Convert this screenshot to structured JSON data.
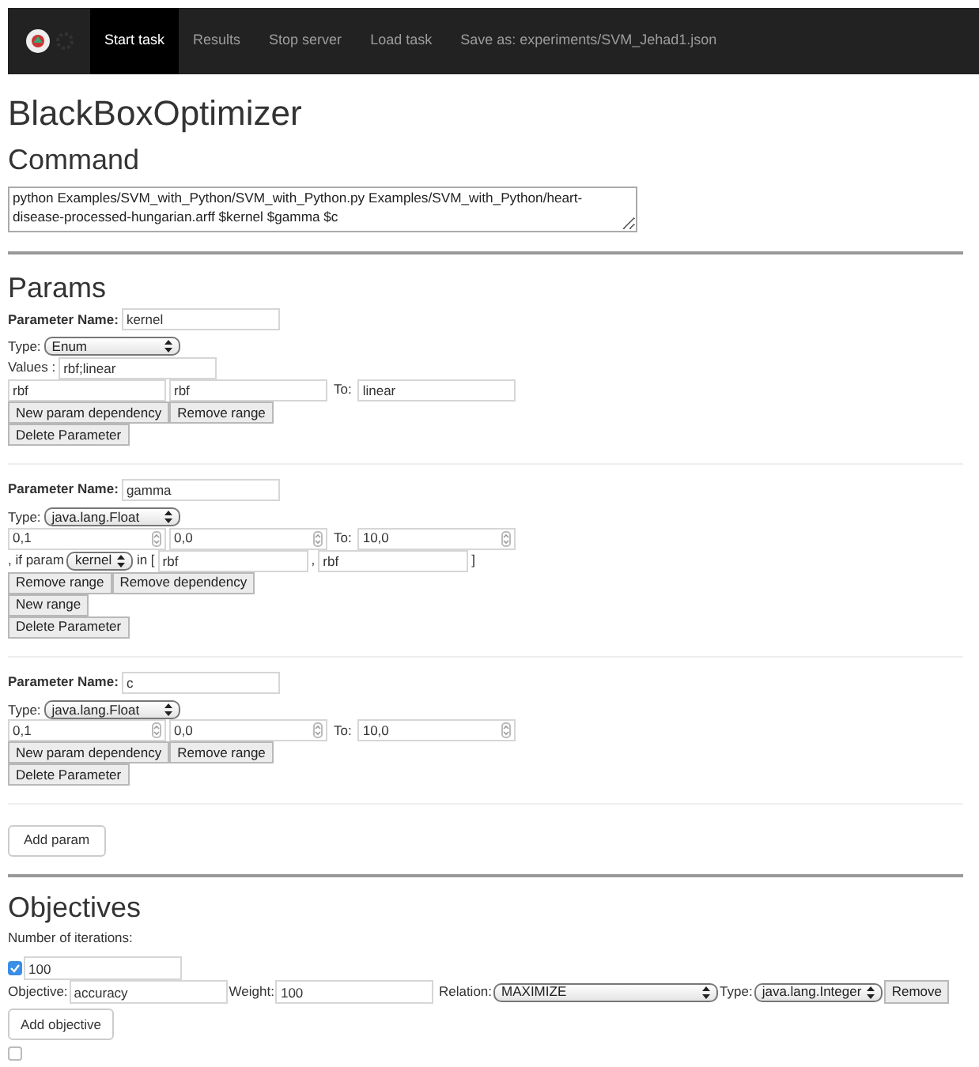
{
  "navbar": {
    "items": [
      {
        "label": "Start task",
        "selected": true
      },
      {
        "label": "Results",
        "selected": false
      },
      {
        "label": "Stop server",
        "selected": false
      },
      {
        "label": "Load task",
        "selected": false
      },
      {
        "label": "Save as: experiments/SVM_Jehad1.json",
        "selected": false
      }
    ]
  },
  "title": "BlackBoxOptimizer",
  "command": {
    "heading": "Command",
    "value": "python Examples/SVM_with_Python/SVM_with_Python.py Examples/SVM_with_Python/heart-disease-processed-hungarian.arff $kernel $gamma $c"
  },
  "params": {
    "heading": "Params",
    "items": [
      {
        "name_label": "Parameter Name:",
        "name": "kernel",
        "type_label": "Type:",
        "type": "Enum",
        "values_label": "Values :",
        "values": "rbf;linear",
        "range": {
          "kind": "text",
          "from": "rbf",
          "from2": "rbf",
          "to_label": "To:",
          "to": "linear"
        },
        "button_rows": [
          [
            "New param dependency",
            "Remove range"
          ],
          [
            "Delete Parameter"
          ]
        ]
      },
      {
        "name_label": "Parameter Name:",
        "name": "gamma",
        "type_label": "Type:",
        "type": "java.lang.Float",
        "range": {
          "kind": "number",
          "from": "0,1",
          "from2": "0,0",
          "to_label": "To:",
          "to": "10,0"
        },
        "dependency": {
          "prefix": ", if param",
          "param": "kernel",
          "in_label": "in [",
          "value1": "rbf",
          "separator": ",",
          "value2": "rbf",
          "suffix": "]"
        },
        "button_rows": [
          [
            "Remove range",
            "Remove dependency"
          ],
          [
            "New range"
          ],
          [
            "Delete Parameter"
          ]
        ]
      },
      {
        "name_label": "Parameter Name:",
        "name": "c",
        "type_label": "Type:",
        "type": "java.lang.Float",
        "range": {
          "kind": "number",
          "from": "0,1",
          "from2": "0,0",
          "to_label": "To:",
          "to": "10,0"
        },
        "button_rows": [
          [
            "New param dependency",
            "Remove range"
          ],
          [
            "Delete Parameter"
          ]
        ]
      }
    ],
    "add_button": "Add param"
  },
  "objectives": {
    "heading": "Objectives",
    "iterations_label": "Number of iterations:",
    "iterations_checked": true,
    "iterations": "100",
    "items": [
      {
        "objective_label": "Objective:",
        "objective": "accuracy",
        "weight_label": "Weight:",
        "weight": "100",
        "relation_label": "Relation:",
        "relation": "MAXIMIZE",
        "type_label": "Type:",
        "type": "java.lang.Integer",
        "remove": "Remove"
      }
    ],
    "add_button": "Add objective",
    "extra_checked": false
  }
}
